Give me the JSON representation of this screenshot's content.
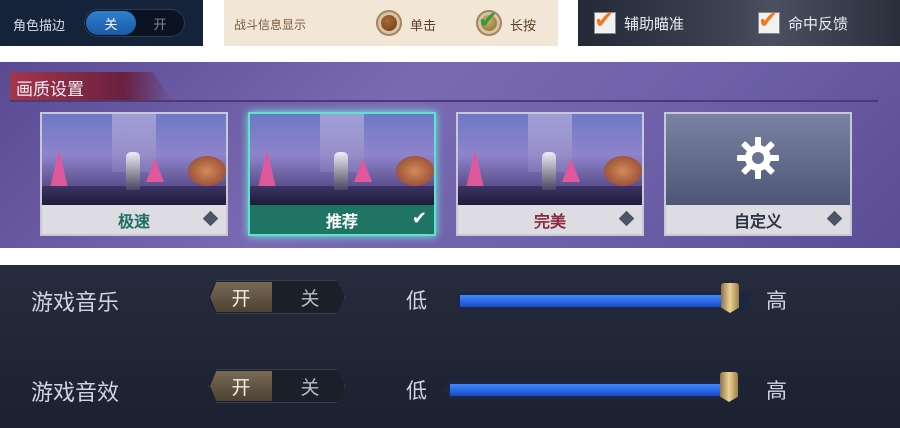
{
  "top": {
    "outline": {
      "label": "角色描边",
      "on_text": "关",
      "off_text": "开"
    },
    "battle_info": {
      "label": "战斗信息显示",
      "options": [
        "单击",
        "长按"
      ],
      "selected": "长按"
    },
    "checks": [
      {
        "label": "辅助瞄准",
        "checked": true
      },
      {
        "label": "命中反馈",
        "checked": true
      }
    ]
  },
  "quality": {
    "title": "画质设置",
    "options": [
      {
        "label": "极速",
        "label_color": "#1f6f64",
        "selected": false
      },
      {
        "label": "推荐",
        "label_color": "#ffffff",
        "selected": true,
        "mark": "✔"
      },
      {
        "label": "完美",
        "label_color": "#8a2a3e",
        "selected": false
      },
      {
        "label": "自定义",
        "label_color": "#2c3240",
        "selected": false,
        "icon": "gear-icon"
      }
    ]
  },
  "audio": {
    "music": {
      "label": "游戏音乐",
      "on": "开",
      "off": "关",
      "low": "低",
      "high": "高",
      "level": 0.95
    },
    "sfx": {
      "label": "游戏音效",
      "on": "开",
      "off": "关",
      "low": "低",
      "high": "高",
      "level": 0.95
    }
  },
  "colors": {
    "accent_blue": "#2f7fd1",
    "selected_teal": "#1f7463",
    "check_orange": "#f07a1a",
    "slider_fill": "#2f6cf0"
  }
}
